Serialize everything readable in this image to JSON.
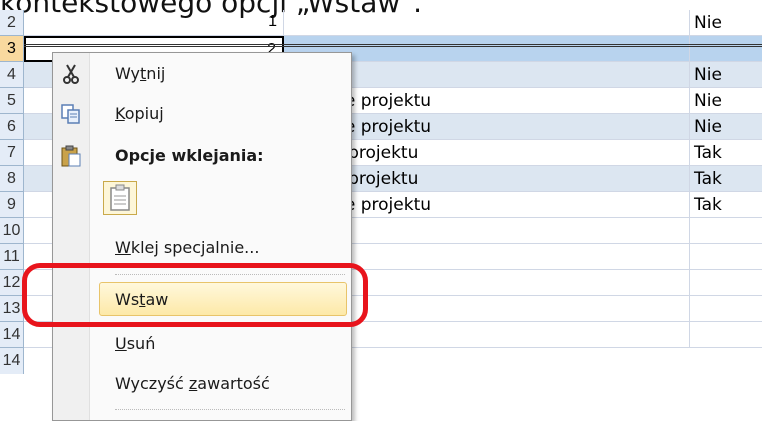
{
  "caption": "kontekstowego opcji „Wstaw\".",
  "rows": [
    {
      "num": "2",
      "b": "1",
      "c": "",
      "d": "Nie"
    },
    {
      "num": "3",
      "b": "2",
      "c": "",
      "d": ""
    },
    {
      "num": "4",
      "b": "",
      "c": "",
      "d": "Nie"
    },
    {
      "num": "5",
      "b": "",
      "c": "towanie projektu",
      "d": "Nie"
    },
    {
      "num": "6",
      "b": "",
      "c": "towanie projektu",
      "d": "Nie"
    },
    {
      "num": "7",
      "b": "",
      "c": "czenie projektu",
      "d": "Tak"
    },
    {
      "num": "8",
      "b": "",
      "c": "czenie projektu",
      "d": "Tak"
    },
    {
      "num": "9",
      "b": "",
      "c": "towanie projektu",
      "d": "Tak"
    },
    {
      "num": "10",
      "b": "",
      "c": "",
      "d": ""
    },
    {
      "num": "11",
      "b": "",
      "c": "",
      "d": ""
    },
    {
      "num": "12",
      "b": "",
      "c": "",
      "d": ""
    },
    {
      "num": "13",
      "b": "",
      "c": "",
      "d": ""
    },
    {
      "num": "14",
      "b": "",
      "c": "",
      "d": ""
    }
  ],
  "menu": {
    "cut": {
      "pre": "Wy",
      "ul": "t",
      "post": "nij",
      "icon": "scissors-icon"
    },
    "copy": {
      "pre": "",
      "ul": "K",
      "post": "opiuj",
      "icon": "copy-icon"
    },
    "paste_options": {
      "label": "Opcje wklejania:",
      "icon": "clipboard-icon"
    },
    "paste_special": {
      "pre": "",
      "ul": "W",
      "post": "klej specjalnie...",
      "icon": "paste-icon"
    },
    "insert": {
      "pre": "Ws",
      "ul": "t",
      "post": "aw"
    },
    "delete": {
      "pre": "",
      "ul": "U",
      "post": "suń"
    },
    "clear": {
      "pre": "Wyczyść ",
      "ul": "z",
      "post": "awartość"
    }
  },
  "colors": {
    "highlight": "#e8141c",
    "band": "#dce6f1",
    "selection": "#b8d3ee"
  }
}
